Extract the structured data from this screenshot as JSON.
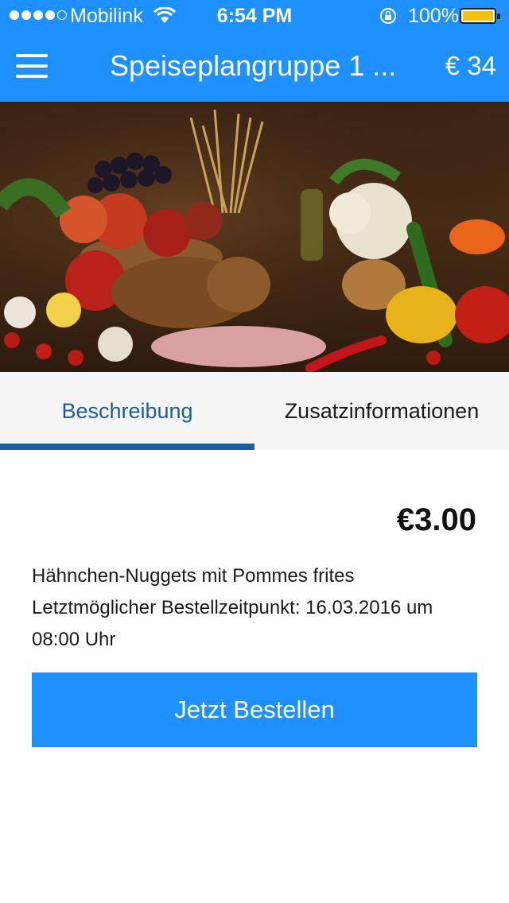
{
  "status_bar": {
    "carrier": "Mobilink",
    "time": "6:54 PM",
    "battery": "100%",
    "signal_strength": 4,
    "battery_level": 1.0
  },
  "header": {
    "title": "Speiseplangruppe 1 ...",
    "balance": "€ 34",
    "menu_icon": "hamburger-menu-icon"
  },
  "hero_image": {
    "subject": "food-still-life-photo"
  },
  "tabs": [
    {
      "label": "Beschreibung",
      "active": true
    },
    {
      "label": "Zusatzinformationen",
      "active": false
    }
  ],
  "product": {
    "price": "€3.00",
    "description_line1": "Hähnchen-Nuggets mit Pommes frites",
    "description_line2": "Letztmöglicher Bestellzeitpunkt: 16.03.2016 um 08:00 Uhr"
  },
  "order_button": {
    "label": "Jetzt Bestellen"
  },
  "colors": {
    "accent": "#1e90ff",
    "tab_active": "#1e5e94",
    "tab_bar_bg": "#f5f5f5"
  }
}
